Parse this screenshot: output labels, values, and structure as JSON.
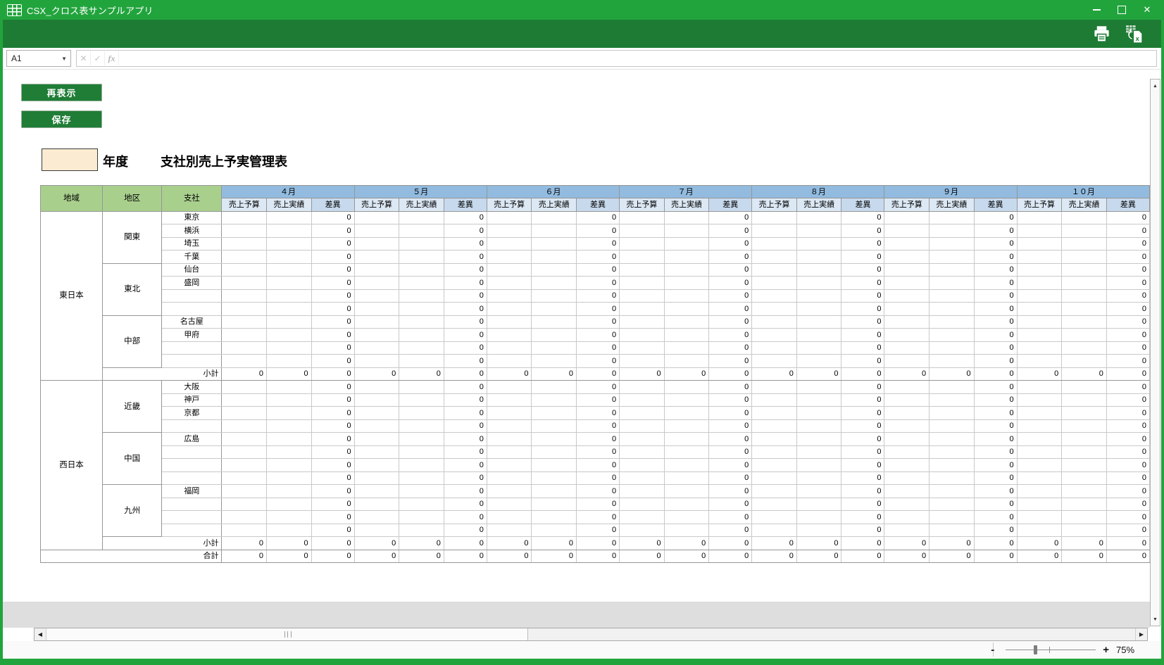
{
  "window": {
    "title": "CSX_クロス表サンプルアプリ"
  },
  "titlebar": {
    "icons": [
      "app-grid-icon",
      "minimize-icon",
      "maximize-icon",
      "close-icon"
    ]
  },
  "toolbar": {
    "icons": [
      "print-icon",
      "export-excel-icon"
    ]
  },
  "formula_bar": {
    "name_box_value": "A1",
    "cancel_icon": "✕",
    "enter_icon": "✓",
    "fx_label": "fx",
    "input_value": ""
  },
  "actions": {
    "redisplay_label": "再表示",
    "save_label": "保存"
  },
  "header": {
    "year_value": "",
    "year_suffix": "年度",
    "title": "支社別売上予実管理表"
  },
  "table": {
    "label_columns": [
      "地域",
      "地区",
      "支社"
    ],
    "months": [
      "４月",
      "５月",
      "６月",
      "７月",
      "８月",
      "９月",
      "１０月"
    ],
    "measure_columns": [
      "売上予算",
      "売上実績",
      "差異"
    ],
    "regions": [
      {
        "name": "東日本",
        "districts": [
          {
            "name": "関東",
            "branches": [
              "東京",
              "横浜",
              "埼玉",
              "千葉"
            ]
          },
          {
            "name": "東北",
            "branches": [
              "仙台",
              "盛岡",
              "",
              ""
            ]
          },
          {
            "name": "中部",
            "branches": [
              "名古屋",
              "甲府",
              "",
              ""
            ]
          }
        ]
      },
      {
        "name": "西日本",
        "districts": [
          {
            "name": "近畿",
            "branches": [
              "大阪",
              "神戸",
              "京都",
              ""
            ]
          },
          {
            "name": "中国",
            "branches": [
              "広島",
              "",
              "",
              ""
            ]
          },
          {
            "name": "九州",
            "branches": [
              "福岡",
              "",
              "",
              ""
            ]
          }
        ]
      }
    ],
    "subtotal_label": "小計",
    "grand_total_label": "合計",
    "budget_cell_value": "",
    "actual_cell_value": "",
    "diff_cell_value": "0",
    "subtotal_cell_value": "0",
    "total_cell_value": "0"
  },
  "status_bar": {
    "zoom_percent": "75%",
    "zoom_minus": "-",
    "zoom_plus": "+"
  },
  "colors": {
    "title_green": "#22a43d",
    "toolbar_green": "#1e7b34",
    "button_green": "#1f7d36",
    "header_green": "#a9cf8d",
    "month_blue": "#92bbdf",
    "measure_blue": "#dce8f4",
    "diff_blue": "#c7d9ed",
    "year_input_bg": "#faebd2",
    "bottom_strip_gray": "#dedede"
  }
}
